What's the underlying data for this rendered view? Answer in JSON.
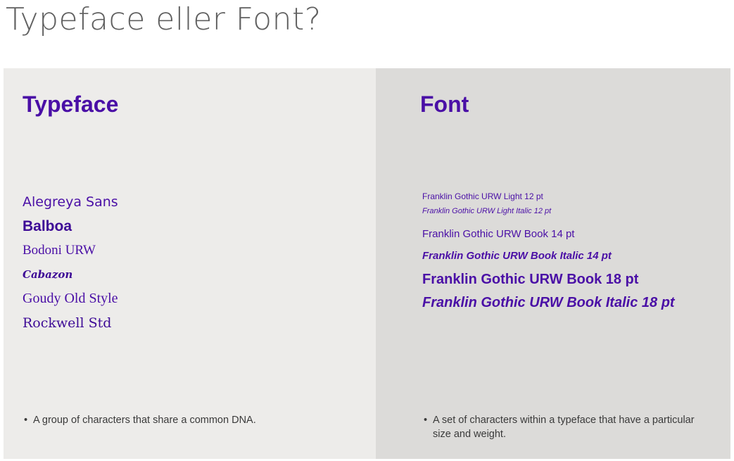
{
  "page": {
    "title": "Typeface eller Font?"
  },
  "typeface_panel": {
    "heading": "Typeface",
    "samples": [
      "Alegreya Sans",
      "Balboa",
      "Bodoni URW",
      "Cabazon",
      "Goudy Old Style",
      "Rockwell Std"
    ],
    "bullet": "A group of characters that share a common DNA."
  },
  "font_panel": {
    "heading": "Font",
    "samples": [
      "Franklin Gothic URW Light 12 pt",
      "Franklin Gothic URW Light Italic 12 pt",
      "Franklin Gothic URW Book 14 pt",
      "Franklin Gothic URW Book Italic 14 pt",
      "Franklin Gothic URW Book 18 pt",
      "Franklin Gothic URW Book Italic 18 pt"
    ],
    "bullet": "A set of characters within a typeface that have a particular size and weight."
  },
  "bullet_symbol": "•",
  "colors": {
    "accent_purple": "#4a0fa6",
    "title_gray": "#606060",
    "left_panel_bg": "#edecea",
    "right_panel_bg": "#dcdbd9",
    "body_text": "#3a3a3a"
  }
}
